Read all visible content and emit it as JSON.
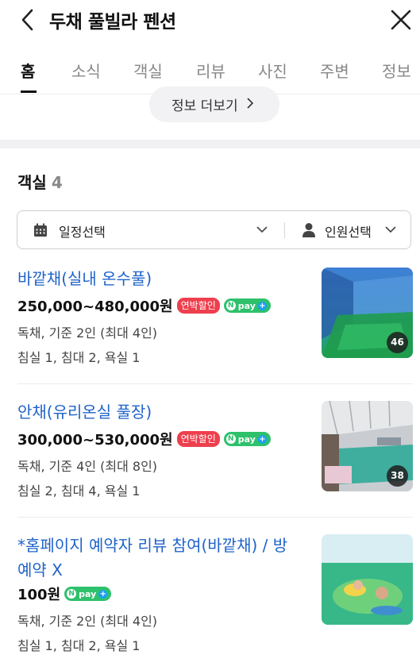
{
  "header": {
    "title": "두채 풀빌라 펜션"
  },
  "tabs": [
    {
      "label": "홈",
      "active": true
    },
    {
      "label": "소식",
      "active": false
    },
    {
      "label": "객실",
      "active": false
    },
    {
      "label": "리뷰",
      "active": false
    },
    {
      "label": "사진",
      "active": false
    },
    {
      "label": "주변",
      "active": false
    },
    {
      "label": "정보",
      "active": false
    }
  ],
  "info_more": {
    "label": "정보 더보기"
  },
  "rooms_section": {
    "title": "객실",
    "count": "4"
  },
  "filters": {
    "date_label": "일정선택",
    "guests_label": "인원선택"
  },
  "badges": {
    "discount": "연박할인",
    "npay": "pay"
  },
  "rooms": [
    {
      "name": "바깥채(실내 온수풀)",
      "price": "250,000~480,000원",
      "discount": true,
      "type_capacity": "독채, 기준 2인 (최대 4인)",
      "rooms_info": "침실 1, 침대 2, 욕실 1",
      "photo_count": "46"
    },
    {
      "name": "안채(유리온실 풀장)",
      "price": "300,000~530,000원",
      "discount": true,
      "type_capacity": "독채, 기준 4인 (최대 8인)",
      "rooms_info": "침실 2, 침대 4, 욕실 1",
      "photo_count": "38"
    },
    {
      "name": "*홈페이지 예약자 리뷰 참여(바깥채) / 방 예약 X",
      "price": "100원",
      "discount": false,
      "type_capacity": "독채, 기준 2인 (최대 4인)",
      "rooms_info": "침실 1, 침대 2, 욕실 1",
      "photo_count": ""
    }
  ],
  "colors": {
    "room_name": "#1f63c9",
    "discount_badge": "#ee3f4d",
    "npay_green": "#2dc16b"
  }
}
